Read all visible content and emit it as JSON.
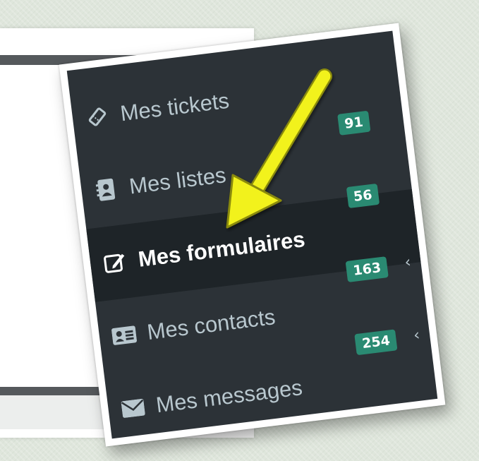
{
  "menu": {
    "items": [
      {
        "label": "Mes tickets",
        "icon": "ticket-icon",
        "badge": "",
        "active": false
      },
      {
        "label": "Mes listes",
        "icon": "address-book-icon",
        "badge": "91",
        "active": false
      },
      {
        "label": "Mes formulaires",
        "icon": "edit-form-icon",
        "badge": "56",
        "active": true
      },
      {
        "label": "Mes contacts",
        "icon": "contact-card-icon",
        "badge": "163",
        "active": false,
        "chevron": "‹"
      },
      {
        "label": "Mes messages",
        "icon": "envelope-icon",
        "badge": "254",
        "active": false,
        "chevron": "‹"
      }
    ]
  },
  "colors": {
    "menu_bg": "#2c3237",
    "active_bg": "#1e2428",
    "badge_bg": "#2a8a72",
    "text": "#b8c7ce",
    "arrow": "#f2f21e"
  }
}
